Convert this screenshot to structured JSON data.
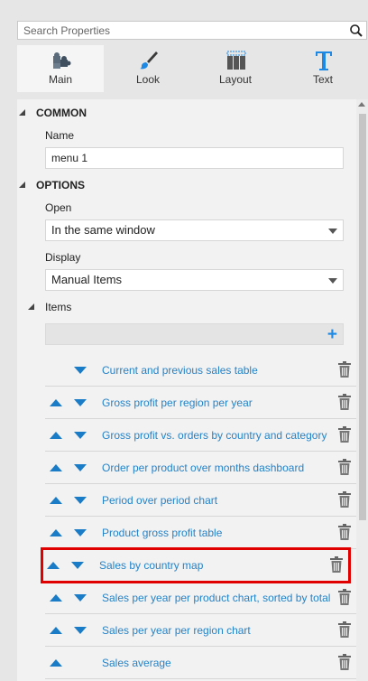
{
  "search": {
    "placeholder": "Search Properties"
  },
  "tabs": [
    {
      "label": "Main",
      "icon": "puzzle-icon",
      "active": true
    },
    {
      "label": "Look",
      "icon": "brush-icon",
      "active": false
    },
    {
      "label": "Layout",
      "icon": "layout-grid-icon",
      "active": false
    },
    {
      "label": "Text",
      "icon": "text-t-icon",
      "active": false
    }
  ],
  "common": {
    "header": "COMMON",
    "name_label": "Name",
    "name_value": "menu 1"
  },
  "options": {
    "header": "OPTIONS",
    "open_label": "Open",
    "open_value": "In the same window",
    "display_label": "Display",
    "display_value": "Manual Items"
  },
  "items": {
    "header": "Items",
    "list": [
      {
        "label": "Current and previous sales table",
        "up": false,
        "down": true
      },
      {
        "label": "Gross profit per region per year",
        "up": true,
        "down": true
      },
      {
        "label": "Gross profit vs. orders by country and category",
        "up": true,
        "down": true
      },
      {
        "label": "Order per product over months dashboard",
        "up": true,
        "down": true
      },
      {
        "label": "Period over period chart",
        "up": true,
        "down": true
      },
      {
        "label": "Product gross profit table",
        "up": true,
        "down": true
      },
      {
        "label": "Sales by country map",
        "up": true,
        "down": true,
        "highlighted": true
      },
      {
        "label": "Sales per year per product chart, sorted by total",
        "up": true,
        "down": true
      },
      {
        "label": "Sales per year per region chart",
        "up": true,
        "down": true
      },
      {
        "label": "Sales average",
        "up": true,
        "down": false
      }
    ]
  },
  "colors": {
    "accent": "#1a7cc6",
    "link": "#2583c8",
    "highlight": "#e00000"
  }
}
